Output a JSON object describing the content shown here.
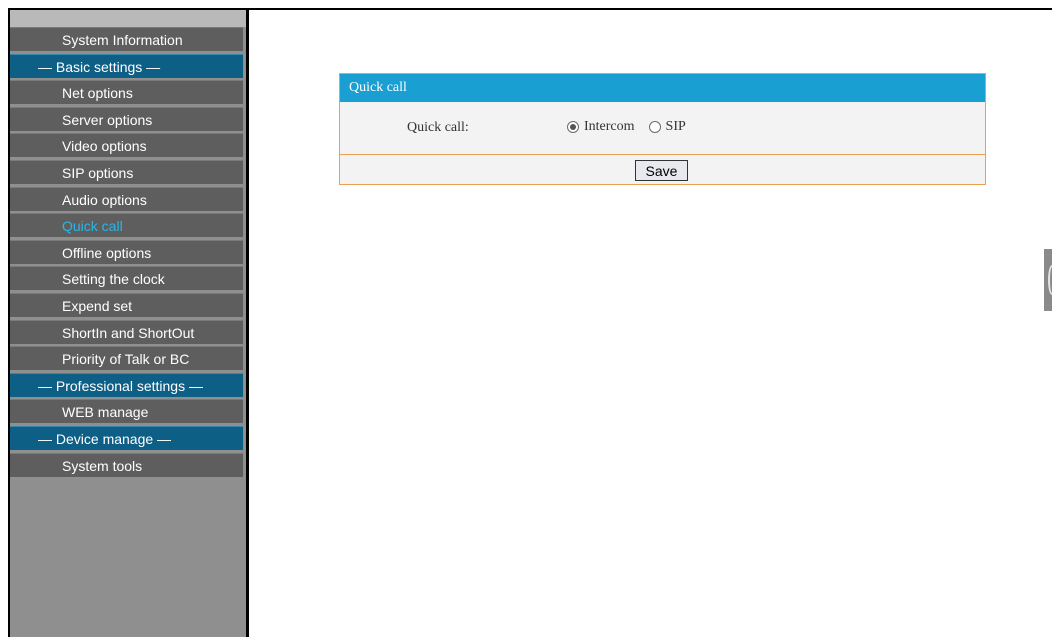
{
  "sidebar": {
    "items": [
      {
        "label": "System Information",
        "type": "item"
      },
      {
        "label": "— Basic settings —",
        "type": "header"
      },
      {
        "label": "Net options",
        "type": "item"
      },
      {
        "label": "Server options",
        "type": "item"
      },
      {
        "label": "Video options",
        "type": "item"
      },
      {
        "label": "SIP options",
        "type": "item"
      },
      {
        "label": "Audio options",
        "type": "item"
      },
      {
        "label": "Quick call",
        "type": "item",
        "active": true
      },
      {
        "label": "Offline options",
        "type": "item"
      },
      {
        "label": "Setting the clock",
        "type": "item"
      },
      {
        "label": "Expend set",
        "type": "item"
      },
      {
        "label": "ShortIn and ShortOut",
        "type": "item"
      },
      {
        "label": "Priority of Talk or BC",
        "type": "item"
      },
      {
        "label": "— Professional settings —",
        "type": "header"
      },
      {
        "label": "WEB manage",
        "type": "item"
      },
      {
        "label": "— Device manage —",
        "type": "header"
      },
      {
        "label": "System tools",
        "type": "item"
      }
    ]
  },
  "panel": {
    "title": "Quick call",
    "field_label": "Quick call:",
    "options": [
      {
        "label": "Intercom",
        "checked": true
      },
      {
        "label": "SIP",
        "checked": false
      }
    ],
    "save_label": "Save"
  },
  "colors": {
    "active_menu": "#2ab5e6",
    "header_bg": "#0e5f86",
    "panel_title_bg": "#1a9fd2",
    "panel_border": "#e8a052"
  }
}
